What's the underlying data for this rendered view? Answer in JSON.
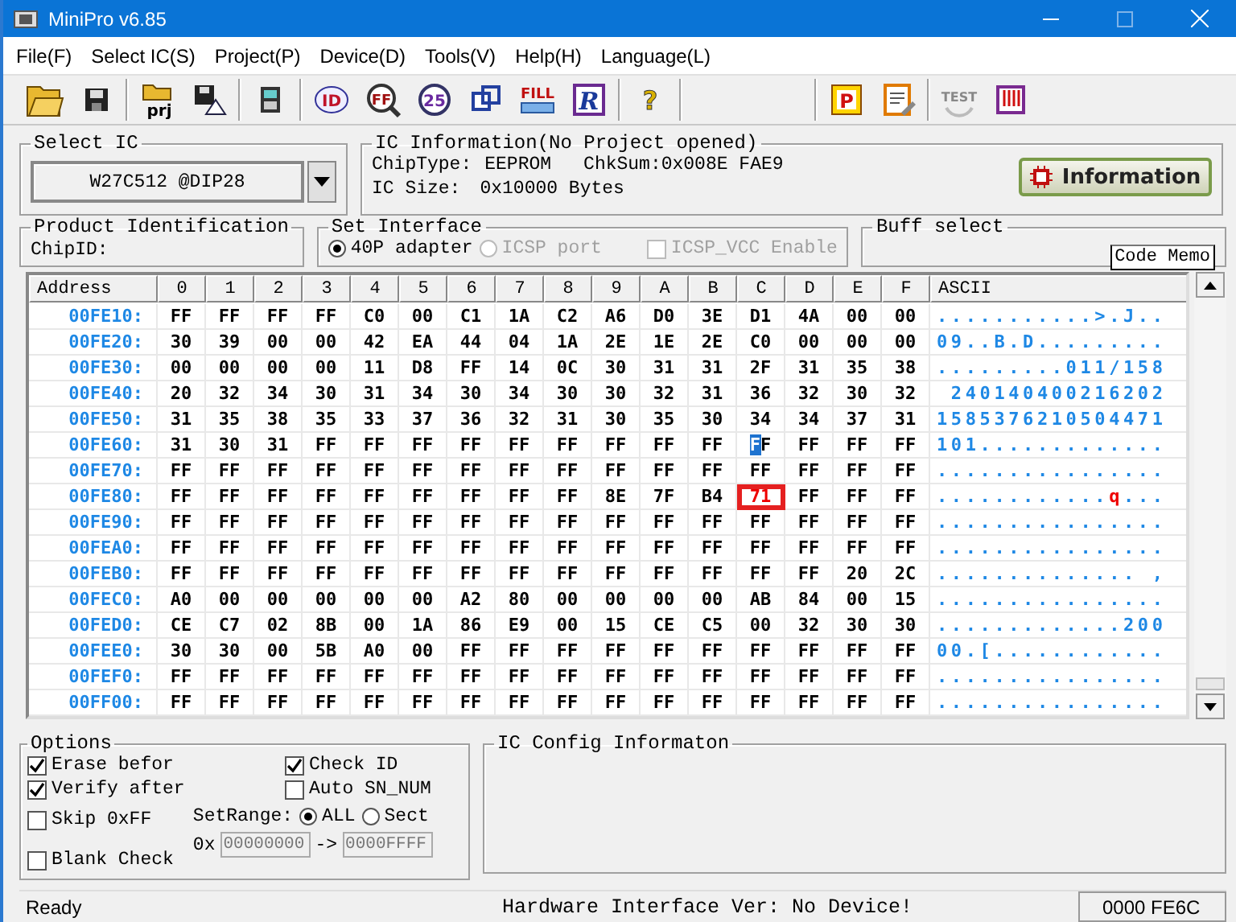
{
  "window": {
    "title": "MiniPro v6.85"
  },
  "menu": [
    "File(F)",
    "Select IC(S)",
    "Project(P)",
    "Device(D)",
    "Tools(V)",
    "Help(H)",
    "Language(L)"
  ],
  "toolbar": [
    {
      "kind": "open",
      "disabled": false
    },
    {
      "kind": "save",
      "disabled": false
    },
    {
      "kind": "sep"
    },
    {
      "kind": "open-project",
      "label": "prj",
      "disabled": false
    },
    {
      "kind": "save-project",
      "disabled": false
    },
    {
      "kind": "sep"
    },
    {
      "kind": "chip",
      "disabled": false
    },
    {
      "kind": "sep"
    },
    {
      "kind": "read",
      "label": "ID",
      "disabled": false
    },
    {
      "kind": "verify",
      "label": "FF",
      "disabled": false
    },
    {
      "kind": "blank",
      "label": "25",
      "disabled": false
    },
    {
      "kind": "copy",
      "disabled": false
    },
    {
      "kind": "fill",
      "label": "FILL",
      "disabled": false
    },
    {
      "kind": "reg",
      "label": "R",
      "disabled": false
    },
    {
      "kind": "sep"
    },
    {
      "kind": "help",
      "label": "?",
      "disabled": false
    },
    {
      "kind": "sep"
    },
    {
      "kind": "space"
    },
    {
      "kind": "sep"
    },
    {
      "kind": "program",
      "label": "P",
      "disabled": false
    },
    {
      "kind": "edit",
      "disabled": false
    },
    {
      "kind": "sep"
    },
    {
      "kind": "test",
      "label": "TEST",
      "disabled": true
    },
    {
      "kind": "pins",
      "disabled": false
    }
  ],
  "select_ic": {
    "title": "Select IC",
    "value": "W27C512 @DIP28"
  },
  "ic_info": {
    "title": "IC Information(No Project opened)",
    "chip_type_label": "ChipType:",
    "chip_type": "EEPROM",
    "checksum": "ChkSum:0x008E FAE9",
    "size_label": "IC Size:",
    "size": "0x10000 Bytes",
    "button": "Information"
  },
  "product_id": {
    "title": "Product Identification",
    "chip_id_label": "ChipID:"
  },
  "interface": {
    "title": "Set Interface",
    "options": [
      {
        "label": "40P adapter",
        "selected": true,
        "disabled": false
      },
      {
        "label": "ICSP port",
        "selected": false,
        "disabled": true
      }
    ],
    "vcc": {
      "label": "ICSP_VCC Enable",
      "checked": false,
      "disabled": true
    }
  },
  "buffer": {
    "title": "Buff select",
    "button": "Code Memo"
  },
  "hex": {
    "columns": [
      "Address",
      "0",
      "1",
      "2",
      "3",
      "4",
      "5",
      "6",
      "7",
      "8",
      "9",
      "A",
      "B",
      "C",
      "D",
      "E",
      "F",
      "ASCII"
    ],
    "rows": [
      {
        "cells": [
          "00FE10:",
          "FF",
          "FF",
          "FF",
          "FF",
          "C0",
          "00",
          "C1",
          "1A",
          "C2",
          "A6",
          "D0",
          "3E",
          "D1",
          "4A",
          "00",
          "00",
          "...........>.J.."
        ]
      },
      {
        "cells": [
          "00FE20:",
          "30",
          "39",
          "00",
          "00",
          "42",
          "EA",
          "44",
          "04",
          "1A",
          "2E",
          "1E",
          "2E",
          "C0",
          "00",
          "00",
          "00",
          "09..B.D........."
        ]
      },
      {
        "cells": [
          "00FE30:",
          "00",
          "00",
          "00",
          "00",
          "11",
          "D8",
          "FF",
          "14",
          "0C",
          "30",
          "31",
          "31",
          "2F",
          "31",
          "35",
          "38",
          ".........011/158"
        ]
      },
      {
        "cells": [
          "00FE40:",
          "20",
          "32",
          "34",
          "30",
          "31",
          "34",
          "30",
          "34",
          "30",
          "30",
          "32",
          "31",
          "36",
          "32",
          "30",
          "32",
          " 240140400216202"
        ]
      },
      {
        "cells": [
          "00FE50:",
          "31",
          "35",
          "38",
          "35",
          "33",
          "37",
          "36",
          "32",
          "31",
          "30",
          "35",
          "30",
          "34",
          "34",
          "37",
          "31",
          "1585376210504471"
        ]
      },
      {
        "cells": [
          "00FE60:",
          "31",
          "30",
          "31",
          "FF",
          "FF",
          "FF",
          "FF",
          "FF",
          "FF",
          "FF",
          "FF",
          "FF",
          {
            "value": "FF",
            "kind": "cursor"
          },
          "FF",
          "FF",
          "FF",
          "101............."
        ]
      },
      {
        "cells": [
          "00FE70:",
          "FF",
          "FF",
          "FF",
          "FF",
          "FF",
          "FF",
          "FF",
          "FF",
          "FF",
          "FF",
          "FF",
          "FF",
          "FF",
          "FF",
          "FF",
          "FF",
          "................"
        ]
      },
      {
        "cells": [
          "00FE80:",
          "FF",
          "FF",
          "FF",
          "FF",
          "FF",
          "FF",
          "FF",
          "FF",
          "FF",
          "8E",
          "7F",
          "B4",
          {
            "value": "71",
            "kind": "modified"
          },
          "FF",
          "FF",
          "FF",
          {
            "kind": "segments",
            "parts": [
              {
                "text": "............",
                "kind": "plain"
              },
              {
                "text": "q",
                "kind": "modified"
              },
              {
                "text": "...",
                "kind": "plain"
              }
            ]
          }
        ]
      },
      {
        "cells": [
          "00FE90:",
          "FF",
          "FF",
          "FF",
          "FF",
          "FF",
          "FF",
          "FF",
          "FF",
          "FF",
          "FF",
          "FF",
          "FF",
          "FF",
          "FF",
          "FF",
          "FF",
          "................"
        ]
      },
      {
        "cells": [
          "00FEA0:",
          "FF",
          "FF",
          "FF",
          "FF",
          "FF",
          "FF",
          "FF",
          "FF",
          "FF",
          "FF",
          "FF",
          "FF",
          "FF",
          "FF",
          "FF",
          "FF",
          "................"
        ]
      },
      {
        "cells": [
          "00FEB0:",
          "FF",
          "FF",
          "FF",
          "FF",
          "FF",
          "FF",
          "FF",
          "FF",
          "FF",
          "FF",
          "FF",
          "FF",
          "FF",
          "FF",
          "20",
          "2C",
          ".............. ,"
        ]
      },
      {
        "cells": [
          "00FEC0:",
          "A0",
          "00",
          "00",
          "00",
          "00",
          "00",
          "A2",
          "80",
          "00",
          "00",
          "00",
          "00",
          "AB",
          "84",
          "00",
          "15",
          "................"
        ]
      },
      {
        "cells": [
          "00FED0:",
          "CE",
          "C7",
          "02",
          "8B",
          "00",
          "1A",
          "86",
          "E9",
          "00",
          "15",
          "CE",
          "C5",
          "00",
          "32",
          "30",
          "30",
          ".............200"
        ]
      },
      {
        "cells": [
          "00FEE0:",
          "30",
          "30",
          "00",
          "5B",
          "A0",
          "00",
          "FF",
          "FF",
          "FF",
          "FF",
          "FF",
          "FF",
          "FF",
          "FF",
          "FF",
          "FF",
          "00.[............"
        ]
      },
      {
        "cells": [
          "00FEF0:",
          "FF",
          "FF",
          "FF",
          "FF",
          "FF",
          "FF",
          "FF",
          "FF",
          "FF",
          "FF",
          "FF",
          "FF",
          "FF",
          "FF",
          "FF",
          "FF",
          "................"
        ]
      },
      {
        "cells": [
          "00FF00:",
          "FF",
          "FF",
          "FF",
          "FF",
          "FF",
          "FF",
          "FF",
          "FF",
          "FF",
          "FF",
          "FF",
          "FF",
          "FF",
          "FF",
          "FF",
          "FF",
          "................"
        ]
      }
    ]
  },
  "options": {
    "title": "Options",
    "checks_left": [
      {
        "label": "Erase befor",
        "checked": true
      },
      {
        "label": "Verify after",
        "checked": true
      },
      {
        "label": "Skip 0xFF",
        "checked": false
      },
      {
        "label": "Blank Check",
        "checked": false
      }
    ],
    "checks_right": [
      {
        "label": "Check ID",
        "checked": true
      },
      {
        "label": "Auto SN_NUM",
        "checked": false
      }
    ],
    "range_label": "SetRange:",
    "range": [
      {
        "label": "ALL",
        "selected": true
      },
      {
        "label": "Sect",
        "selected": false
      }
    ],
    "prefix": "0x",
    "from": "00000000",
    "arrow": "->",
    "to": "0000FFFF"
  },
  "config": {
    "title": "IC Config Informaton"
  },
  "status": {
    "left": "Ready",
    "center": "Hardware Interface Ver: No Device!",
    "right": "0000 FE6C"
  }
}
